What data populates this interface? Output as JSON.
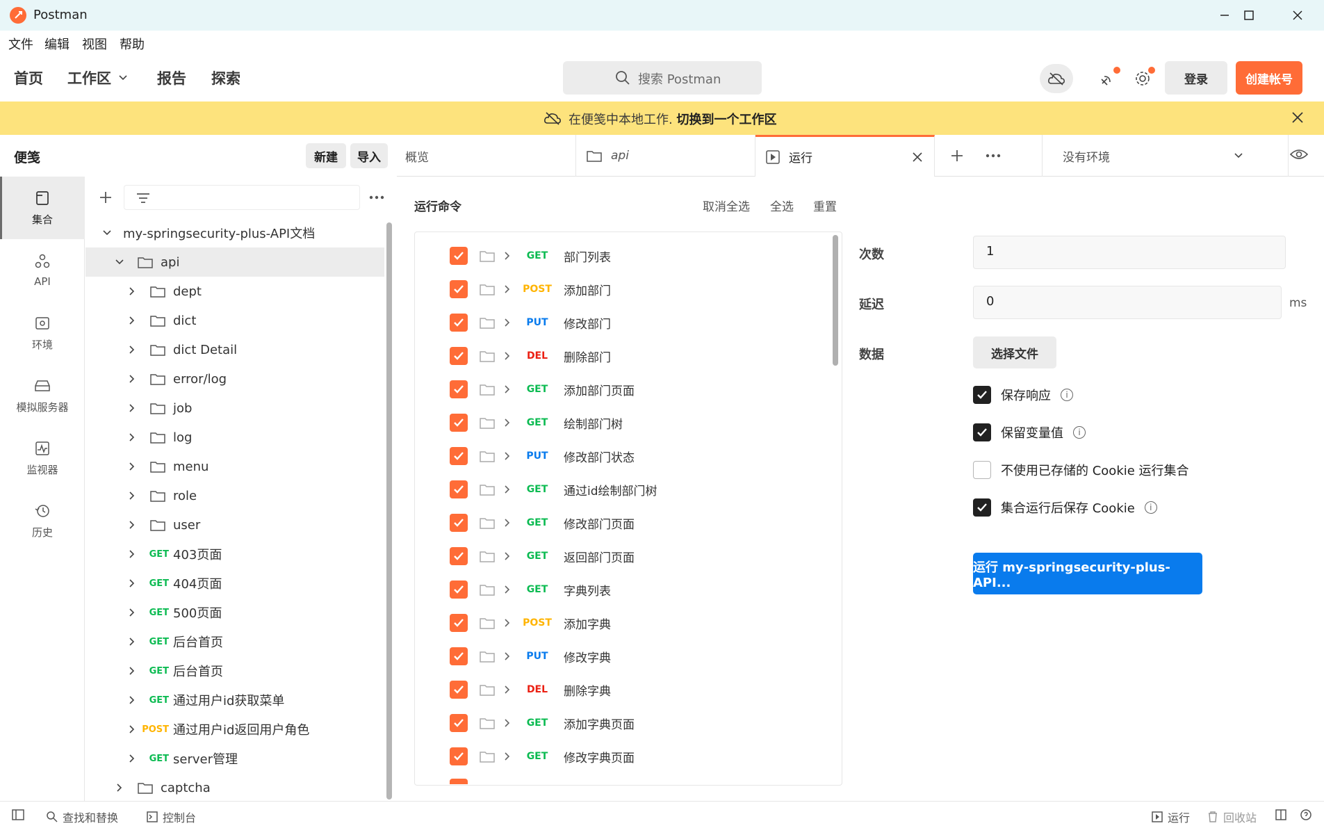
{
  "window": {
    "title": "Postman"
  },
  "menu": [
    "文件",
    "编辑",
    "视图",
    "帮助"
  ],
  "header": {
    "nav": [
      "首页",
      "工作区",
      "报告",
      "探索"
    ],
    "search_placeholder": "搜索 Postman",
    "login": "登录",
    "signup": "创建帐号"
  },
  "banner": {
    "text": "在便笺中本地工作.",
    "link": "切换到一个工作区"
  },
  "rail": [
    {
      "label": "集合",
      "icon": "collection-icon"
    },
    {
      "label": "API",
      "icon": "api-icon"
    },
    {
      "label": "环境",
      "icon": "environment-icon"
    },
    {
      "label": "模拟服务器",
      "icon": "mock-server-icon"
    },
    {
      "label": "监视器",
      "icon": "monitor-icon"
    },
    {
      "label": "历史",
      "icon": "history-icon"
    }
  ],
  "sidebar": {
    "title": "便笺",
    "new": "新建",
    "import": "导入",
    "collection": "my-springsecurity-plus-API文档",
    "root": "api",
    "folders": [
      "dept",
      "dict",
      "dict Detail",
      "error/log",
      "job",
      "log",
      "menu",
      "role",
      "user"
    ],
    "requests": [
      {
        "method": "GET",
        "name": "403页面"
      },
      {
        "method": "GET",
        "name": "404页面"
      },
      {
        "method": "GET",
        "name": "500页面"
      },
      {
        "method": "GET",
        "name": "后台首页"
      },
      {
        "method": "GET",
        "name": "后台首页"
      },
      {
        "method": "GET",
        "name": "通过用户id获取菜单"
      },
      {
        "method": "POST",
        "name": "通过用户id返回用户角色"
      },
      {
        "method": "GET",
        "name": "server管理"
      }
    ],
    "captcha": "captcha"
  },
  "tabs": {
    "overview": "概览",
    "api": "api",
    "runner": "运行",
    "environment": "没有环境"
  },
  "runner": {
    "title": "运行命令",
    "deselect_all": "取消全选",
    "select_all": "全选",
    "reset": "重置",
    "items": [
      {
        "method": "GET",
        "name": "部门列表"
      },
      {
        "method": "POST",
        "name": "添加部门"
      },
      {
        "method": "PUT",
        "name": "修改部门"
      },
      {
        "method": "DEL",
        "name": "删除部门"
      },
      {
        "method": "GET",
        "name": "添加部门页面"
      },
      {
        "method": "GET",
        "name": "绘制部门树"
      },
      {
        "method": "PUT",
        "name": "修改部门状态"
      },
      {
        "method": "GET",
        "name": "通过id绘制部门树"
      },
      {
        "method": "GET",
        "name": "修改部门页面"
      },
      {
        "method": "GET",
        "name": "返回部门页面"
      },
      {
        "method": "GET",
        "name": "字典列表"
      },
      {
        "method": "POST",
        "name": "添加字典"
      },
      {
        "method": "PUT",
        "name": "修改字典"
      },
      {
        "method": "DEL",
        "name": "删除字典"
      },
      {
        "method": "GET",
        "name": "添加字典页面"
      },
      {
        "method": "GET",
        "name": "修改字典页面"
      }
    ]
  },
  "settings": {
    "iterations_label": "次数",
    "iterations_value": "1",
    "delay_label": "延迟",
    "delay_value": "0",
    "delay_unit": "ms",
    "data_label": "数据",
    "select_file": "选择文件",
    "options": [
      {
        "label": "保存响应",
        "checked": true,
        "info": true
      },
      {
        "label": "保留变量值",
        "checked": true,
        "info": true
      },
      {
        "label": "不使用已存储的 Cookie 运行集合",
        "checked": false,
        "info": false
      },
      {
        "label": "集合运行后保存 Cookie",
        "checked": true,
        "info": true
      }
    ],
    "run_button": "运行 my-springsecurity-plus-API..."
  },
  "statusbar": {
    "find_replace": "查找和替换",
    "console": "控制台",
    "runner": "运行",
    "trash": "回收站"
  },
  "colors": {
    "accent": "#ff6c37",
    "primary": "#097bed",
    "get": "#0cbb52",
    "post": "#ffb400",
    "put": "#097bed",
    "del": "#eb2013"
  }
}
